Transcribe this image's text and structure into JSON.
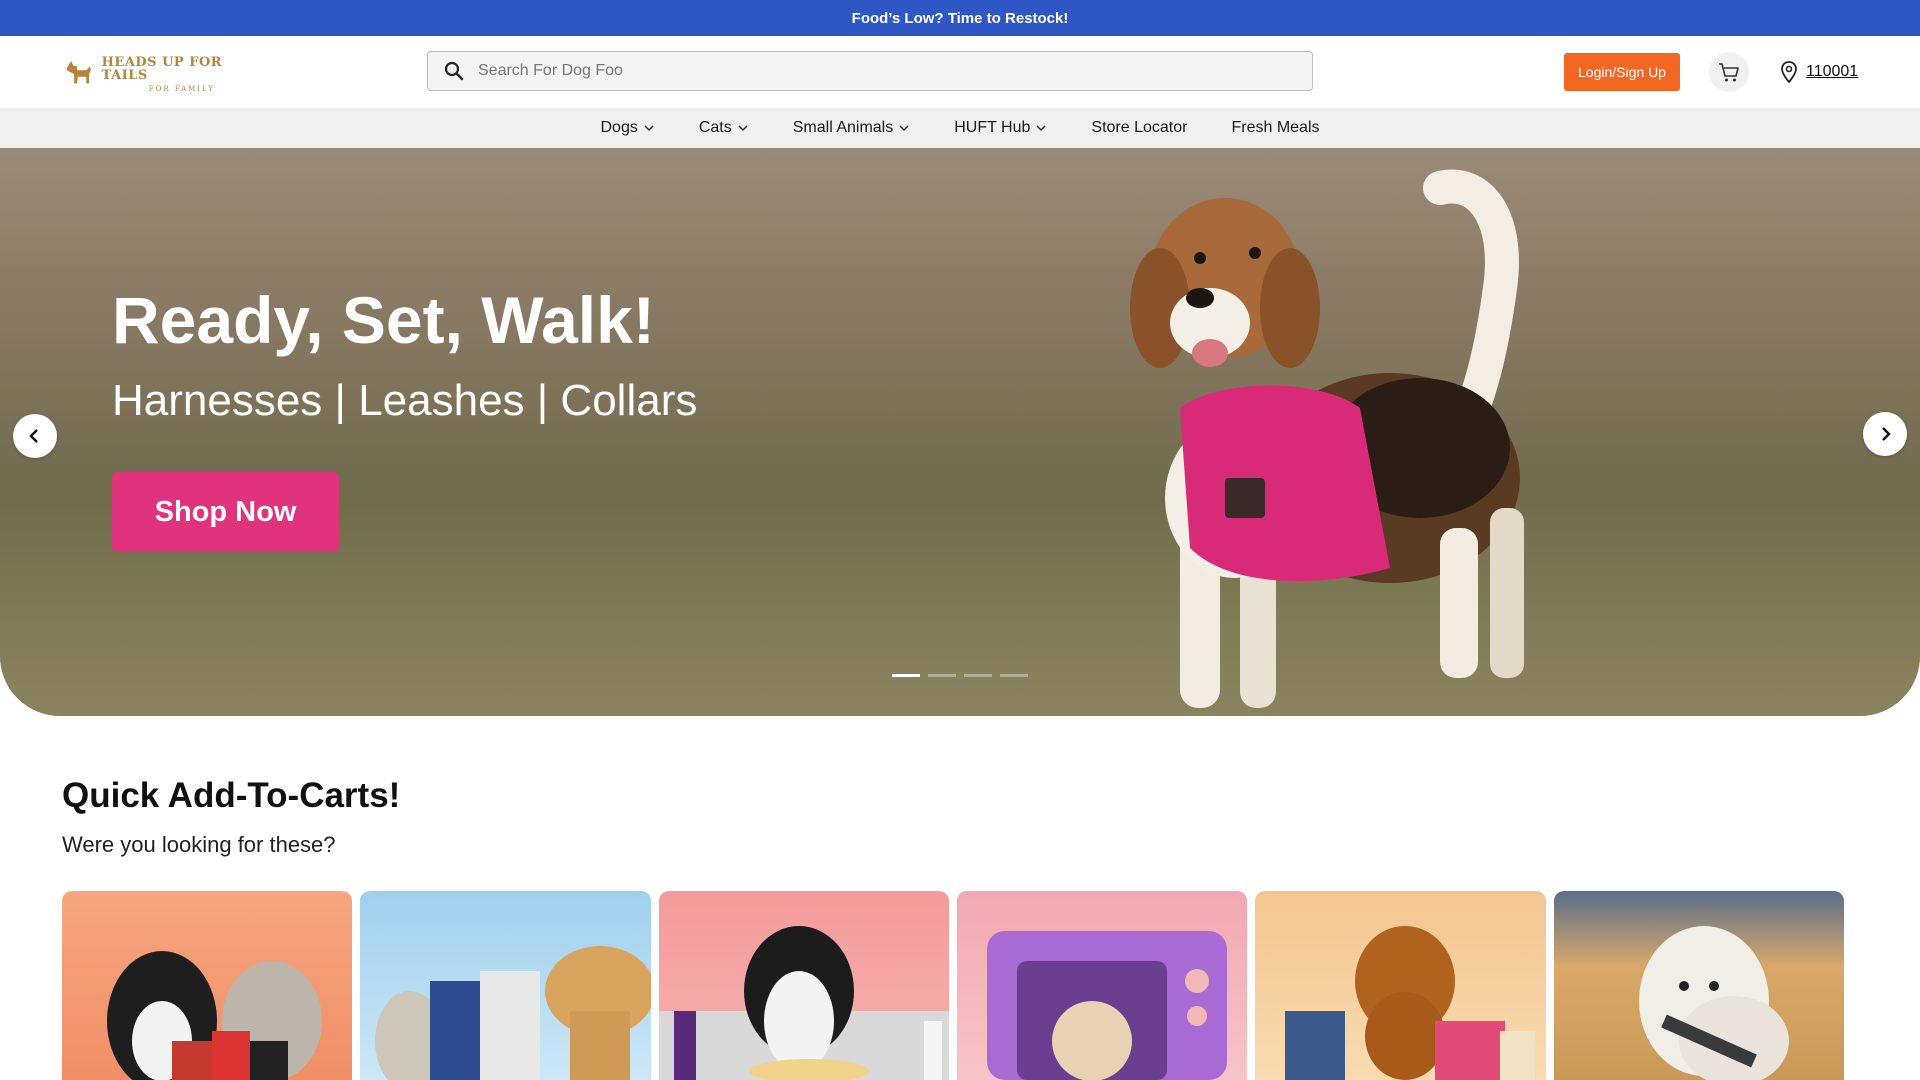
{
  "announcement": {
    "text": "Food’s Low? Time to Restock!"
  },
  "header": {
    "logo": {
      "main": "HEADS UP FOR TAILS",
      "sub": "FOR FAMILY"
    },
    "search": {
      "value": "",
      "placeholder": "Search For Dog Foo"
    },
    "login_label": "Login/Sign Up",
    "pincode": "110001",
    "colors": {
      "accent": "#f26722",
      "topbar": "#2e56c4"
    }
  },
  "nav": {
    "items": [
      {
        "label": "Dogs",
        "dropdown": true
      },
      {
        "label": "Cats",
        "dropdown": true
      },
      {
        "label": "Small Animals",
        "dropdown": true
      },
      {
        "label": "HUFT Hub",
        "dropdown": true
      },
      {
        "label": "Store Locator",
        "dropdown": false
      },
      {
        "label": "Fresh Meals",
        "dropdown": false
      }
    ]
  },
  "hero": {
    "title": "Ready, Set, Walk!",
    "subtitle": "Harnesses | Leashes | Collars",
    "cta": "Shop Now",
    "slide_count": 4,
    "active_slide": 1,
    "cta_color": "#e0327d"
  },
  "quick_add": {
    "title": "Quick Add-To-Carts!",
    "subtitle": "Were you looking for these?",
    "cards": [
      {
        "icon": "dog-cat-food-card"
      },
      {
        "icon": "royal-canin-card"
      },
      {
        "icon": "grooming-card"
      },
      {
        "icon": "cat-bed-card"
      },
      {
        "icon": "treats-card"
      },
      {
        "icon": "harness-card"
      }
    ]
  }
}
